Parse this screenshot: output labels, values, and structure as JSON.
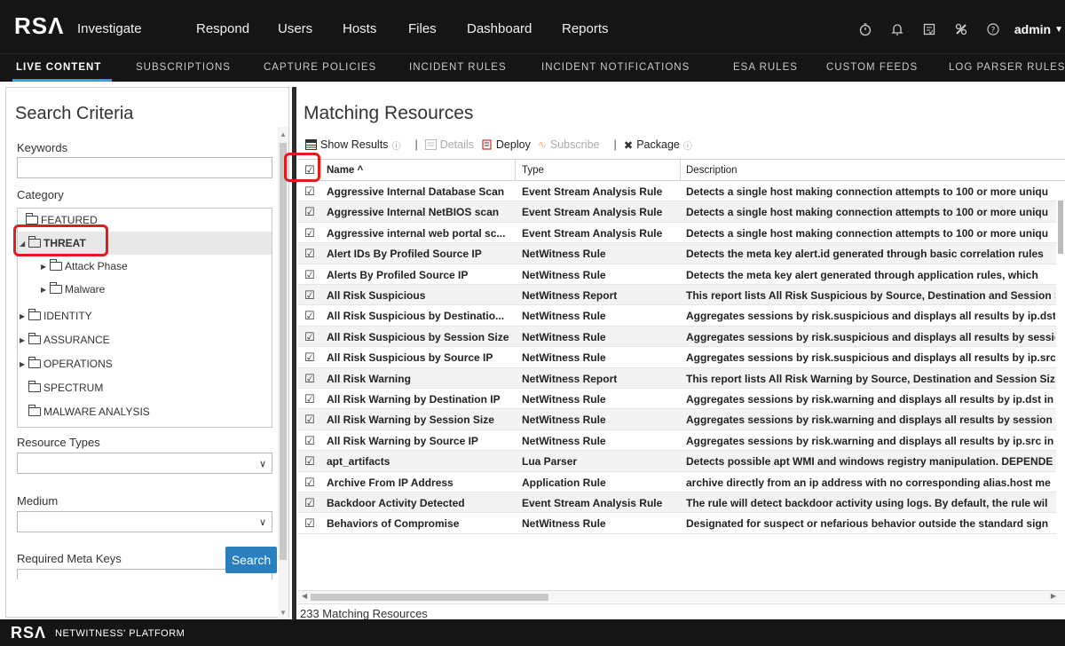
{
  "topnav": {
    "logo": "RSΛ",
    "items": [
      "Investigate",
      "Respond",
      "Users",
      "Hosts",
      "Files",
      "Dashboard",
      "Reports"
    ],
    "user": "admin",
    "icons": [
      "stopwatch-icon",
      "bell-icon",
      "tasks-icon",
      "tools-icon",
      "help-icon"
    ]
  },
  "subnav": {
    "items": [
      "LIVE CONTENT",
      "SUBSCRIPTIONS",
      "CAPTURE POLICIES",
      "INCIDENT RULES",
      "INCIDENT NOTIFICATIONS",
      "ESA RULES",
      "CUSTOM FEEDS",
      "LOG PARSER RULES"
    ],
    "active": "LIVE CONTENT"
  },
  "search_criteria": {
    "title": "Search Criteria",
    "keywords_label": "Keywords",
    "keywords_value": "",
    "category_label": "Category",
    "tree": [
      {
        "label": "FEATURED",
        "level": 0,
        "expander": "none"
      },
      {
        "label": "THREAT",
        "level": 0,
        "expander": "expanded"
      },
      {
        "label": "Attack Phase",
        "level": 1,
        "expander": "collapsed"
      },
      {
        "label": "Malware",
        "level": 1,
        "expander": "collapsed"
      },
      {
        "label": "IDENTITY",
        "level": 0,
        "expander": "collapsed"
      },
      {
        "label": "ASSURANCE",
        "level": 0,
        "expander": "collapsed"
      },
      {
        "label": "OPERATIONS",
        "level": 0,
        "expander": "collapsed"
      },
      {
        "label": "SPECTRUM",
        "level": 0,
        "expander": "none"
      },
      {
        "label": "MALWARE ANALYSIS",
        "level": 0,
        "expander": "none"
      }
    ],
    "resource_types_label": "Resource Types",
    "resource_types_value": "",
    "medium_label": "Medium",
    "medium_value": "",
    "required_meta_keys_label": "Required Meta Keys",
    "search_button": "Search"
  },
  "results": {
    "title": "Matching Resources",
    "toolbar": {
      "show_results": "Show Results",
      "details": "Details",
      "deploy": "Deploy",
      "subscribe": "Subscribe",
      "package": "Package"
    },
    "columns": [
      "Name ^",
      "Type",
      "Description"
    ],
    "rows": [
      {
        "name": "Aggressive Internal Database Scan",
        "type": "Event Stream Analysis Rule",
        "description": "Detects a single host making connection attempts to 100 or more uniqu"
      },
      {
        "name": "Aggressive Internal NetBIOS scan",
        "type": "Event Stream Analysis Rule",
        "description": "Detects a single host making connection attempts to 100 or more uniqu"
      },
      {
        "name": "Aggressive internal web portal sc...",
        "type": "Event Stream Analysis Rule",
        "description": "Detects a single host making connection attempts to 100 or more uniqu"
      },
      {
        "name": "Alert IDs By Profiled Source IP",
        "type": "NetWitness Rule",
        "description": "Detects the meta key alert.id generated through basic correlation rules"
      },
      {
        "name": "Alerts By Profiled Source IP",
        "type": "NetWitness Rule",
        "description": "Detects the meta key alert generated through application rules, which"
      },
      {
        "name": "All Risk Suspicious",
        "type": "NetWitness Report",
        "description": "This report lists All Risk Suspicious by Source, Destination and Session S"
      },
      {
        "name": "All Risk Suspicious by Destinatio...",
        "type": "NetWitness Rule",
        "description": "Aggregates sessions by risk.suspicious and displays all results by ip.dst"
      },
      {
        "name": "All Risk Suspicious by Session Size",
        "type": "NetWitness Rule",
        "description": "Aggregates sessions by risk.suspicious and displays all results by sessio"
      },
      {
        "name": "All Risk Suspicious by Source IP",
        "type": "NetWitness Rule",
        "description": "Aggregates sessions by risk.suspicious and displays all results by ip.src i"
      },
      {
        "name": "All Risk Warning",
        "type": "NetWitness Report",
        "description": "This report lists All Risk Warning by Source, Destination and Session Siz"
      },
      {
        "name": "All Risk Warning by Destination IP",
        "type": "NetWitness Rule",
        "description": "Aggregates sessions by risk.warning and displays all results by ip.dst in"
      },
      {
        "name": "All Risk Warning by Session Size",
        "type": "NetWitness Rule",
        "description": "Aggregates sessions by risk.warning and displays all results by session s"
      },
      {
        "name": "All Risk Warning by Source IP",
        "type": "NetWitness Rule",
        "description": "Aggregates sessions by risk.warning and displays all results by ip.src in"
      },
      {
        "name": "apt_artifacts",
        "type": "Lua Parser",
        "description": "Detects possible apt WMI and windows registry manipulation. DEPENDE"
      },
      {
        "name": "Archive From IP Address",
        "type": "Application Rule",
        "description": "archive directly from an ip address with no corresponding alias.host me"
      },
      {
        "name": "Backdoor Activity Detected",
        "type": "Event Stream Analysis Rule",
        "description": "The rule will detect backdoor activity using logs. By default, the rule wil"
      },
      {
        "name": "Behaviors of Compromise",
        "type": "NetWitness Rule",
        "description": "Designated for suspect or nefarious behavior outside the standard sign"
      }
    ],
    "count_text": "233 Matching Resources"
  },
  "footer": {
    "logo": "RSΛ",
    "text": "NETWITNESS' PLATFORM"
  },
  "colors": {
    "nav_bg": "#151515",
    "accent": "#2ea3dd",
    "search_button": "#2a7fbf",
    "highlight": "#e41b1b"
  }
}
